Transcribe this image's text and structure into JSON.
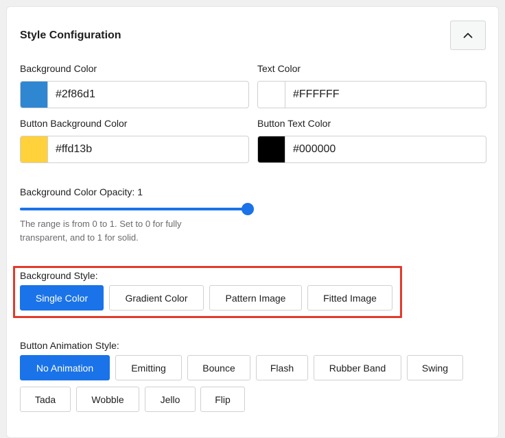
{
  "panel": {
    "title": "Style Configuration"
  },
  "colors": {
    "background": {
      "label": "Background Color",
      "value": "#2f86d1",
      "swatch": "#2f86d1"
    },
    "text": {
      "label": "Text Color",
      "value": "#FFFFFF",
      "swatch": "#FFFFFF"
    },
    "button_background": {
      "label": "Button Background Color",
      "value": "#ffd13b",
      "swatch": "#ffd13b"
    },
    "button_text": {
      "label": "Button Text Color",
      "value": "#000000",
      "swatch": "#000000"
    }
  },
  "opacity": {
    "label": "Background Color Opacity: 1",
    "value": 1,
    "min": 0,
    "max": 1,
    "help": "The range is from 0 to 1. Set to 0 for fully transparent, and to 1 for solid."
  },
  "background_style": {
    "label": "Background Style:",
    "options": [
      "Single Color",
      "Gradient Color",
      "Pattern Image",
      "Fitted Image"
    ],
    "selected": "Single Color"
  },
  "animation_style": {
    "label": "Button Animation Style:",
    "options": [
      "No Animation",
      "Emitting",
      "Bounce",
      "Flash",
      "Rubber Band",
      "Swing",
      "Tada",
      "Wobble",
      "Jello",
      "Flip"
    ],
    "selected": "No Animation"
  },
  "theme": {
    "accent": "#1a73e8",
    "highlight": "#e23a2b"
  },
  "icons": {
    "collapse": "chevron-up-icon"
  }
}
